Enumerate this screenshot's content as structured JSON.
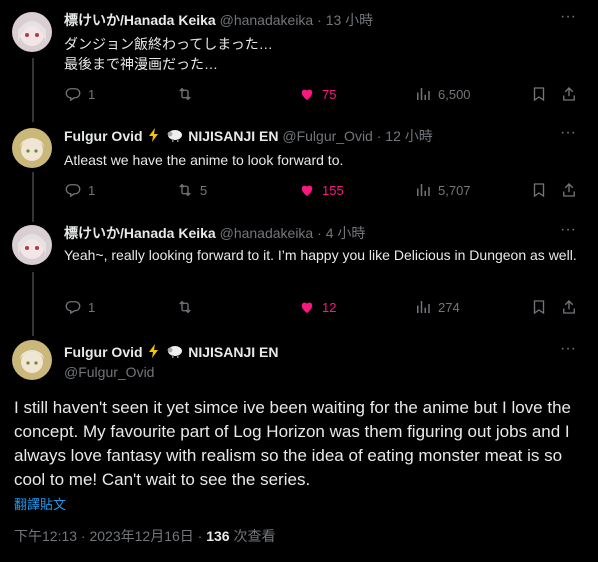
{
  "tweets": [
    {
      "name": "標けいか/Hanada Keika",
      "handle": "@hanadakeika",
      "sep": "·",
      "time": "13 小時",
      "text": "ダンジョン飯終わってしまった…\n最後まで神漫画だった…",
      "replies": "1",
      "retweets": "",
      "likes": "75",
      "views": "6,500"
    },
    {
      "name": "Fulgur Ovid",
      "name_suffix": "NIJISANJI EN",
      "handle": "@Fulgur_Ovid",
      "sep": "·",
      "time": "12 小時",
      "text": "Atleast we have the anime to look forward to.",
      "replies": "1",
      "retweets": "5",
      "likes": "155",
      "views": "5,707"
    },
    {
      "name": "標けいか/Hanada Keika",
      "handle": "@hanadakeika",
      "sep": "·",
      "time": "4 小時",
      "text": "Yeah~, really looking forward to it. I’m happy you like Delicious in Dungeon as well.",
      "replies": "1",
      "retweets": "",
      "likes": "12",
      "views": "274"
    }
  ],
  "main": {
    "name": "Fulgur Ovid",
    "name_suffix": "NIJISANJI EN",
    "handle": "@Fulgur_Ovid",
    "text": "I still haven't seen it yet simce ive been waiting for the anime but I love the concept. My favourite part of Log Horizon was them figuring out jobs and I always love fantasy with realism so the idea of eating monster meat is so cool to me! Can't wait to see the series.",
    "translate": "翻譯貼文",
    "time": "下午12:13 · 2023年12月16日 · ",
    "views": "136",
    "views_label": " 次查看"
  },
  "colors": {
    "background": "#000000",
    "text": "#e7e9ea",
    "muted": "#71767b",
    "like": "#f91880",
    "link": "#1d9bf0"
  },
  "icons": [
    "reply-icon",
    "retweet-icon",
    "heart-filled-icon",
    "views-icon",
    "bookmark-icon",
    "share-icon",
    "more-icon",
    "lightning-icon",
    "sheep-icon"
  ]
}
